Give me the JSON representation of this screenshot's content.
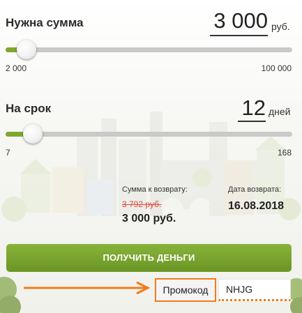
{
  "amount": {
    "label": "Нужна сумма",
    "value": "3 000",
    "unit": "руб.",
    "min_label": "2 000",
    "max_label": "100 000",
    "min": 2000,
    "max": 100000,
    "current": 3000
  },
  "term": {
    "label": "На срок",
    "value": "12",
    "unit": "дней",
    "min_label": "7",
    "max_label": "168",
    "min": 7,
    "max": 168,
    "current": 12
  },
  "summary": {
    "return_label": "Сумма к возврату:",
    "old_amount": "3 792 руб.",
    "new_amount": "3 000 руб.",
    "date_label": "Дата возврата:",
    "date": "16.08.2018"
  },
  "cta": {
    "label": "ПОЛУЧИТЬ ДЕНЬГИ"
  },
  "promo": {
    "button_label": "Промокод",
    "input_value": "NHJG"
  },
  "colors": {
    "accent_green": "#7ea72e",
    "promo_orange": "#f07c1c",
    "strike_red": "#e14b3b"
  }
}
